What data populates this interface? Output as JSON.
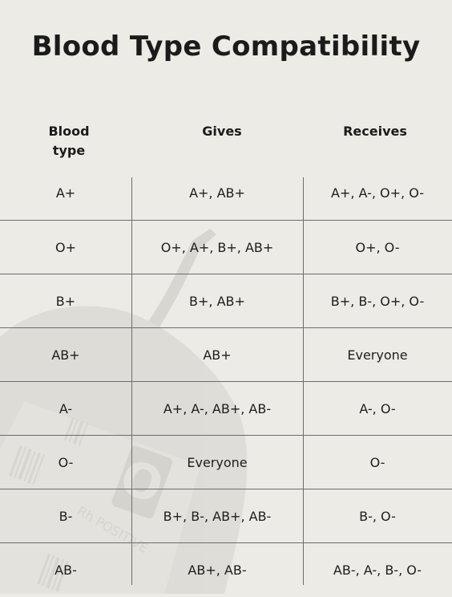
{
  "title": "Blood Type Compatibility",
  "headers": {
    "blood_type": "Blood type",
    "gives": "Gives",
    "receives": "Receives"
  },
  "rows": [
    {
      "type": "A+",
      "gives": "A+, AB+",
      "receives": "A+, A-, O+, O-"
    },
    {
      "type": "O+",
      "gives": "O+, A+, B+, AB+",
      "receives": "O+, O-"
    },
    {
      "type": "B+",
      "gives": "B+, AB+",
      "receives": "B+, B-, O+, O-"
    },
    {
      "type": "AB+",
      "gives": "AB+",
      "receives": "Everyone"
    },
    {
      "type": "A-",
      "gives": "A+, A-, AB+, AB-",
      "receives": "A-, O-"
    },
    {
      "type": "O-",
      "gives": "Everyone",
      "receives": "O-"
    },
    {
      "type": "B-",
      "gives": "B+, B-, AB+, AB-",
      "receives": "B-, O-"
    },
    {
      "type": "AB-",
      "gives": "AB+, AB-",
      "receives": "AB-, A-, B-, O-"
    }
  ],
  "colors": {
    "background": "#ecebe6",
    "text": "#1b1b1b",
    "rule": "#6c6c6c",
    "watermark": "#cfcdc8"
  },
  "watermark": {
    "icon": "blood-bag-icon",
    "label": "Rh POSITIVE",
    "mark": "O"
  }
}
